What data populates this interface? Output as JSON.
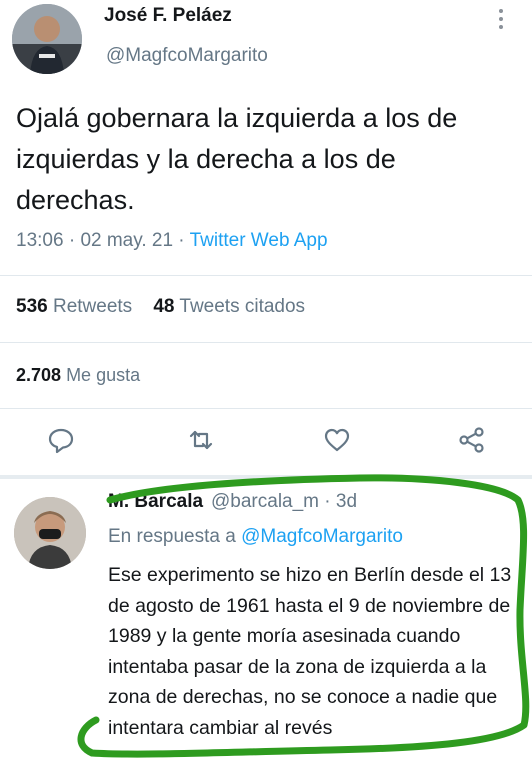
{
  "tweet": {
    "author_name": "José F. Peláez",
    "author_handle": "@MagfcoMargarito",
    "text": "Ojalá gobernara la izquierda a los de izquierdas y la derecha a los de derechas.",
    "time": "13:06",
    "date": "02 may. 21",
    "source": "Twitter Web App",
    "retweets_count": "536",
    "retweets_label": "Retweets",
    "quotes_count": "48",
    "quotes_label": "Tweets citados",
    "likes_count": "2.708",
    "likes_label": "Me gusta",
    "actions": [
      "reply-icon",
      "retweet-icon",
      "like-icon",
      "share-icon"
    ]
  },
  "reply": {
    "author_name": "M. Barcala",
    "author_handle": "@barcala_m",
    "age": "3d",
    "in_reply_to_label": "En respuesta a",
    "in_reply_to_handle": "@MagfcoMargarito",
    "text": "Ese experimento se hizo en Berlín desde el 13 de agosto de 1961 hasta el 9 de noviembre de 1989 y la gente moría asesinada cuando intentaba pasar de la zona de izquierda a la zona de derechas, no se conoce a nadie que intentara cambiar al revés"
  },
  "colors": {
    "text": "#14171a",
    "muted": "#657786",
    "link": "#1da1f2",
    "divider": "#e1e8ed",
    "annotation": "#2e9b1f"
  }
}
